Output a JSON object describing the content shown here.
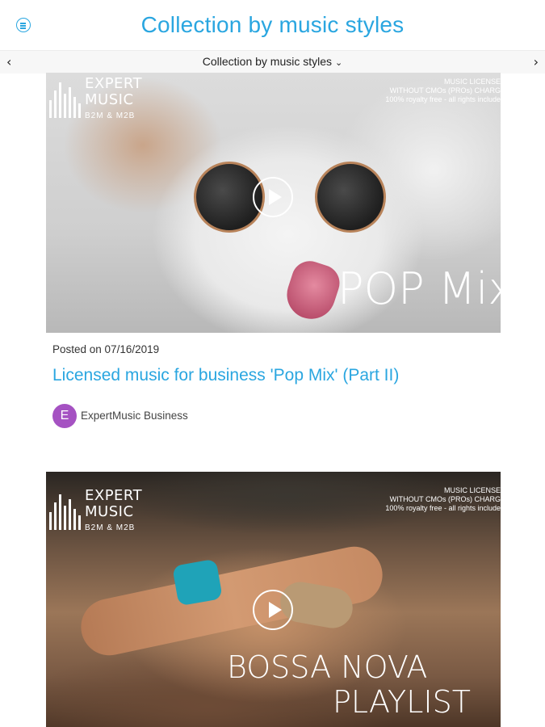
{
  "header": {
    "title": "Collection by music styles",
    "menu_icon": "hamburger-circle-icon"
  },
  "subnav": {
    "selected": "Collection by music styles",
    "left_icon": "chevron-left-icon",
    "right_icon": "chevron-right-icon",
    "dropdown_icon": "chevron-down-icon"
  },
  "colors": {
    "accent": "#2aa6e0",
    "avatar": "#a552c2"
  },
  "posts": [
    {
      "logo": {
        "line1": "EXPERT",
        "line2": "MUSIC",
        "sub": "B2M & M2B"
      },
      "license": [
        "MUSIC LICENSE",
        "WITHOUT CMOs (PROs) CHARG",
        "100% royalty free - all rights include"
      ],
      "overlay_text": "POP Mix",
      "posted": "Posted on 07/16/2019",
      "title": "Licensed music for business 'Pop Mix' (Part II)",
      "author_initial": "E",
      "author": "ExpertMusic Business"
    },
    {
      "logo": {
        "line1": "EXPERT",
        "line2": "MUSIC",
        "sub": "B2M & M2B"
      },
      "license": [
        "MUSIC LICENSE",
        "WITHOUT CMOs (PROs) CHARG",
        "100% royalty free - all rights include"
      ],
      "overlay_text_1": "BOSSA NOVA",
      "overlay_text_2": "PLAYLIST"
    }
  ]
}
